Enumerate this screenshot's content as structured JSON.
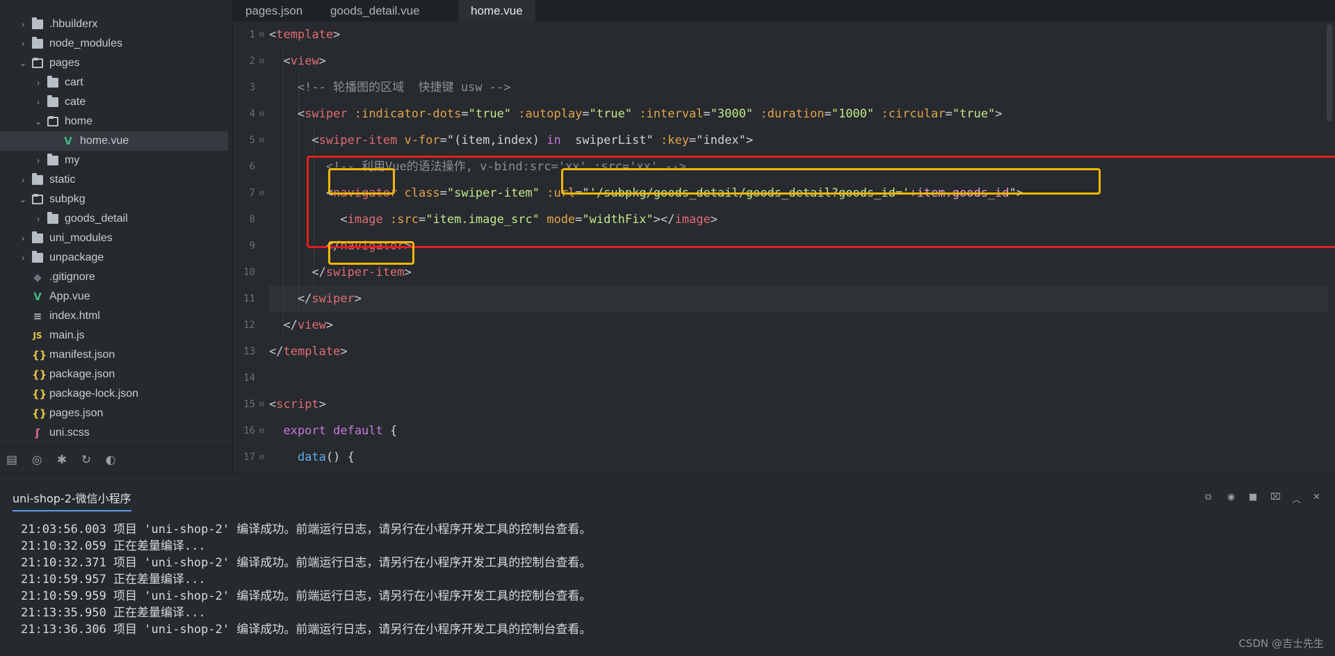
{
  "sidebar": {
    "items": [
      {
        "label": ".hbuilderx",
        "type": "folder",
        "expanded": false,
        "depth": 0
      },
      {
        "label": "node_modules",
        "type": "folder",
        "expanded": false,
        "depth": 0
      },
      {
        "label": "pages",
        "type": "folder",
        "expanded": true,
        "depth": 0
      },
      {
        "label": "cart",
        "type": "folder",
        "expanded": false,
        "depth": 1
      },
      {
        "label": "cate",
        "type": "folder",
        "expanded": false,
        "depth": 1
      },
      {
        "label": "home",
        "type": "folder",
        "expanded": true,
        "depth": 1
      },
      {
        "label": "home.vue",
        "type": "vue",
        "depth": 2,
        "selected": true
      },
      {
        "label": "my",
        "type": "folder",
        "expanded": false,
        "depth": 1
      },
      {
        "label": "static",
        "type": "folder",
        "expanded": false,
        "depth": 0
      },
      {
        "label": "subpkg",
        "type": "folder",
        "expanded": true,
        "depth": 0
      },
      {
        "label": "goods_detail",
        "type": "folder",
        "expanded": false,
        "depth": 1
      },
      {
        "label": "uni_modules",
        "type": "folder",
        "expanded": false,
        "depth": 0
      },
      {
        "label": "unpackage",
        "type": "folder",
        "expanded": false,
        "depth": 0
      },
      {
        "label": ".gitignore",
        "type": "gitignore",
        "depth": 0
      },
      {
        "label": "App.vue",
        "type": "vue",
        "depth": 0
      },
      {
        "label": "index.html",
        "type": "html",
        "depth": 0
      },
      {
        "label": "main.js",
        "type": "js",
        "depth": 0
      },
      {
        "label": "manifest.json",
        "type": "json",
        "depth": 0
      },
      {
        "label": "package.json",
        "type": "json",
        "depth": 0
      },
      {
        "label": "package-lock.json",
        "type": "json",
        "depth": 0
      },
      {
        "label": "pages.json",
        "type": "json",
        "depth": 0
      },
      {
        "label": "uni.scss",
        "type": "scss",
        "depth": 0
      }
    ],
    "tools": [
      "files-icon",
      "binoculars-icon",
      "bug-icon",
      "search-replace-icon",
      "palette-icon"
    ]
  },
  "tabs": [
    {
      "label": "pages.json",
      "active": false
    },
    {
      "label": "goods_detail.vue",
      "active": false
    },
    {
      "label": "home.vue",
      "active": true
    }
  ],
  "editor": {
    "line_numbers": [
      "1",
      "2",
      "3",
      "4",
      "5",
      "6",
      "7",
      "8",
      "9",
      "10",
      "11",
      "12",
      "13",
      "14",
      "15",
      "16",
      "17"
    ],
    "folds": [
      "⊟",
      "⊟",
      "",
      "⊟",
      "⊟",
      "",
      "⊟",
      "",
      "",
      "",
      "",
      "",
      "",
      "",
      "⊟",
      "⊟",
      "⊟"
    ],
    "lines": [
      [
        {
          "t": "<",
          "c": "br"
        },
        {
          "t": "template",
          "c": "tag"
        },
        {
          "t": ">",
          "c": "br"
        }
      ],
      [
        {
          "t": "  <",
          "c": "br"
        },
        {
          "t": "view",
          "c": "tag"
        },
        {
          "t": ">",
          "c": "br"
        }
      ],
      [
        {
          "t": "    <!-- 轮播图的区域  快捷键 usw -->",
          "c": "cmt"
        }
      ],
      [
        {
          "t": "    <",
          "c": "br"
        },
        {
          "t": "swiper",
          "c": "tag"
        },
        {
          "t": " :indicator-dots",
          "c": "attr"
        },
        {
          "t": "=",
          "c": "plain"
        },
        {
          "t": "\"true\"",
          "c": "str"
        },
        {
          "t": " :autoplay",
          "c": "attr"
        },
        {
          "t": "=",
          "c": "plain"
        },
        {
          "t": "\"true\"",
          "c": "str"
        },
        {
          "t": " :interval",
          "c": "attr"
        },
        {
          "t": "=",
          "c": "plain"
        },
        {
          "t": "\"3000\"",
          "c": "str"
        },
        {
          "t": " :duration",
          "c": "attr"
        },
        {
          "t": "=",
          "c": "plain"
        },
        {
          "t": "\"1000\"",
          "c": "str"
        },
        {
          "t": " :circular",
          "c": "attr"
        },
        {
          "t": "=",
          "c": "plain"
        },
        {
          "t": "\"true\"",
          "c": "str"
        },
        {
          "t": ">",
          "c": "br"
        }
      ],
      [
        {
          "t": "      <",
          "c": "br"
        },
        {
          "t": "swiper-item",
          "c": "tag"
        },
        {
          "t": " v-for",
          "c": "attr"
        },
        {
          "t": "=\"(item,index) ",
          "c": "plain"
        },
        {
          "t": "in",
          "c": "kw"
        },
        {
          "t": "  swiperList\" ",
          "c": "plain"
        },
        {
          "t": ":key",
          "c": "attr"
        },
        {
          "t": "=\"index\">",
          "c": "plain"
        }
      ],
      [
        {
          "t": "        <!-- 利用Vue的语法操作, v-bind:src='xx' :src='xx' -->",
          "c": "cmt"
        }
      ],
      [
        {
          "t": "        <",
          "c": "br"
        },
        {
          "t": "navigator",
          "c": "tag"
        },
        {
          "t": " class",
          "c": "attr"
        },
        {
          "t": "=",
          "c": "plain"
        },
        {
          "t": "\"swiper-item\"",
          "c": "str"
        },
        {
          "t": " :url",
          "c": "attr"
        },
        {
          "t": "=\"",
          "c": "plain"
        },
        {
          "t": "'/subpkg/goods_detail/goods_detail?goods_id='",
          "c": "str"
        },
        {
          "t": "+item.goods_id",
          "c": "str2"
        },
        {
          "t": "\">",
          "c": "plain"
        }
      ],
      [
        {
          "t": "          <",
          "c": "br"
        },
        {
          "t": "image",
          "c": "tag"
        },
        {
          "t": " :src",
          "c": "attr"
        },
        {
          "t": "=",
          "c": "plain"
        },
        {
          "t": "\"item.image_src\"",
          "c": "str"
        },
        {
          "t": " mode",
          "c": "attr"
        },
        {
          "t": "=",
          "c": "plain"
        },
        {
          "t": "\"widthFix\"",
          "c": "str"
        },
        {
          "t": "></",
          "c": "br"
        },
        {
          "t": "image",
          "c": "tag"
        },
        {
          "t": ">",
          "c": "br"
        }
      ],
      [
        {
          "t": "        </",
          "c": "br"
        },
        {
          "t": "navigator",
          "c": "tag"
        },
        {
          "t": ">",
          "c": "br"
        }
      ],
      [
        {
          "t": "      </",
          "c": "br"
        },
        {
          "t": "swiper-item",
          "c": "tag"
        },
        {
          "t": ">",
          "c": "br"
        }
      ],
      [
        {
          "t": "    </",
          "c": "br"
        },
        {
          "t": "swiper",
          "c": "tag"
        },
        {
          "t": ">",
          "c": "br"
        }
      ],
      [
        {
          "t": "  </",
          "c": "br"
        },
        {
          "t": "view",
          "c": "tag"
        },
        {
          "t": ">",
          "c": "br"
        }
      ],
      [
        {
          "t": "</",
          "c": "br"
        },
        {
          "t": "template",
          "c": "tag"
        },
        {
          "t": ">",
          "c": "br"
        }
      ],
      [],
      [
        {
          "t": "<",
          "c": "br"
        },
        {
          "t": "script",
          "c": "tag"
        },
        {
          "t": ">",
          "c": "br"
        }
      ],
      [
        {
          "t": "  export default",
          "c": "kw"
        },
        {
          "t": " {",
          "c": "plain"
        }
      ],
      [
        {
          "t": "    ",
          "c": "plain"
        },
        {
          "t": "data",
          "c": "fn"
        },
        {
          "t": "() {",
          "c": "plain"
        }
      ]
    ],
    "current_line": 11
  },
  "console": {
    "tab_label": "uni-shop-2-微信小程序",
    "lines": [
      "21:03:56.003 项目 'uni-shop-2' 编译成功。前端运行日志，请另行在小程序开发工具的控制台查看。",
      "21:10:32.059 正在差量编译...",
      "21:10:32.371 项目 'uni-shop-2' 编译成功。前端运行日志，请另行在小程序开发工具的控制台查看。",
      "21:10:59.957 正在差量编译...",
      "21:10:59.959 项目 'uni-shop-2' 编译成功。前端运行日志，请另行在小程序开发工具的控制台查看。",
      "21:13:35.950 正在差量编译...",
      "21:13:36.306 项目 'uni-shop-2' 编译成功。前端运行日志，请另行在小程序开发工具的控制台查看。"
    ],
    "tools": [
      "open-external-icon",
      "target-icon",
      "stop-icon",
      "clear-icon",
      "collapse-icon",
      "close-icon"
    ]
  },
  "watermark": "CSDN @吉士先生",
  "colors": {
    "red_box": "#e02020",
    "yellow_box": "#f2b705",
    "accent": "#5a9cf0"
  }
}
